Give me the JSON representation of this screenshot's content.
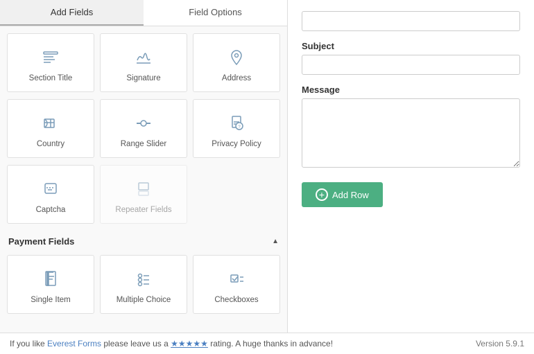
{
  "tabs": [
    {
      "label": "Add Fields",
      "active": true
    },
    {
      "label": "Field Options",
      "active": false
    }
  ],
  "field_groups": [
    {
      "fields": [
        {
          "name": "Section Title",
          "icon": "section-title-icon"
        },
        {
          "name": "Signature",
          "icon": "signature-icon"
        },
        {
          "name": "Address",
          "icon": "address-icon"
        }
      ]
    },
    {
      "fields": [
        {
          "name": "Country",
          "icon": "country-icon"
        },
        {
          "name": "Range Slider",
          "icon": "range-slider-icon"
        },
        {
          "name": "Privacy Policy",
          "icon": "privacy-policy-icon"
        }
      ]
    },
    {
      "fields": [
        {
          "name": "Captcha",
          "icon": "captcha-icon"
        },
        {
          "name": "Repeater Fields",
          "icon": "repeater-fields-icon",
          "disabled": true
        }
      ]
    }
  ],
  "payment_section": {
    "label": "Payment Fields",
    "fields": [
      {
        "name": "Single Item",
        "icon": "single-item-icon"
      },
      {
        "name": "Multiple Choice",
        "icon": "multiple-choice-icon"
      },
      {
        "name": "Checkboxes",
        "icon": "checkboxes-icon"
      }
    ]
  },
  "right_panel": {
    "top_input_placeholder": "",
    "subject_label": "Subject",
    "subject_placeholder": "",
    "message_label": "Message",
    "message_placeholder": "",
    "add_row_label": "Add Row"
  },
  "footer": {
    "text_before_link": "If you like ",
    "link_text": "Everest Forms",
    "text_after_link": " please leave us a ",
    "stars": "★★★★★",
    "text_end": " rating. A huge thanks in advance!",
    "version": "Version 5.9.1"
  }
}
